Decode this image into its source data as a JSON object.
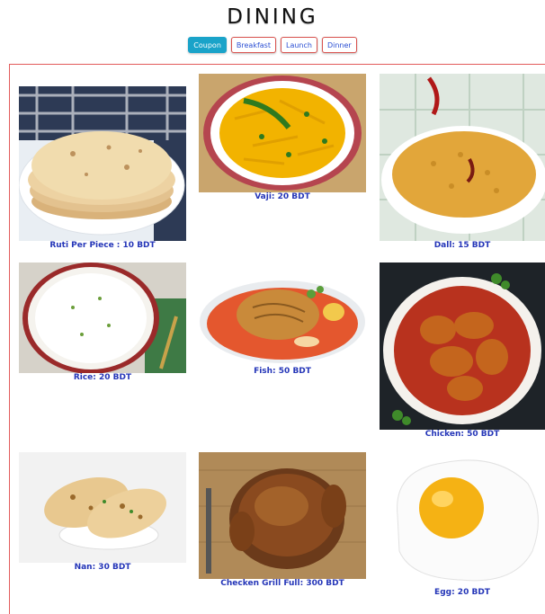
{
  "page": {
    "title": "DINING"
  },
  "tabs": [
    {
      "label": "Coupon",
      "active": true
    },
    {
      "label": "Breakfast",
      "active": false
    },
    {
      "label": "Launch",
      "active": false
    },
    {
      "label": "Dinner",
      "active": false
    }
  ],
  "menu": [
    {
      "label": "Ruti Per Piece : 10 BDT",
      "image": "ruti-photo"
    },
    {
      "label": "Vaji: 20 BDT",
      "image": "vaji-photo"
    },
    {
      "label": "Dall: 15 BDT",
      "image": "dall-photo"
    },
    {
      "label": "Rice: 20 BDT",
      "image": "rice-photo"
    },
    {
      "label": "Fish: 50 BDT",
      "image": "fish-photo"
    },
    {
      "label": "Chicken: 50 BDT",
      "image": "chicken-photo"
    },
    {
      "label": "Nan: 30 BDT",
      "image": "nan-photo"
    },
    {
      "label": "Checken Grill Full: 300 BDT",
      "image": "grill-photo"
    },
    {
      "label": "Egg: 20 BDT",
      "image": "egg-photo"
    }
  ],
  "colors": {
    "accent": "#1aa3c9",
    "border": "#e25b5b",
    "caption": "#2536b8"
  }
}
